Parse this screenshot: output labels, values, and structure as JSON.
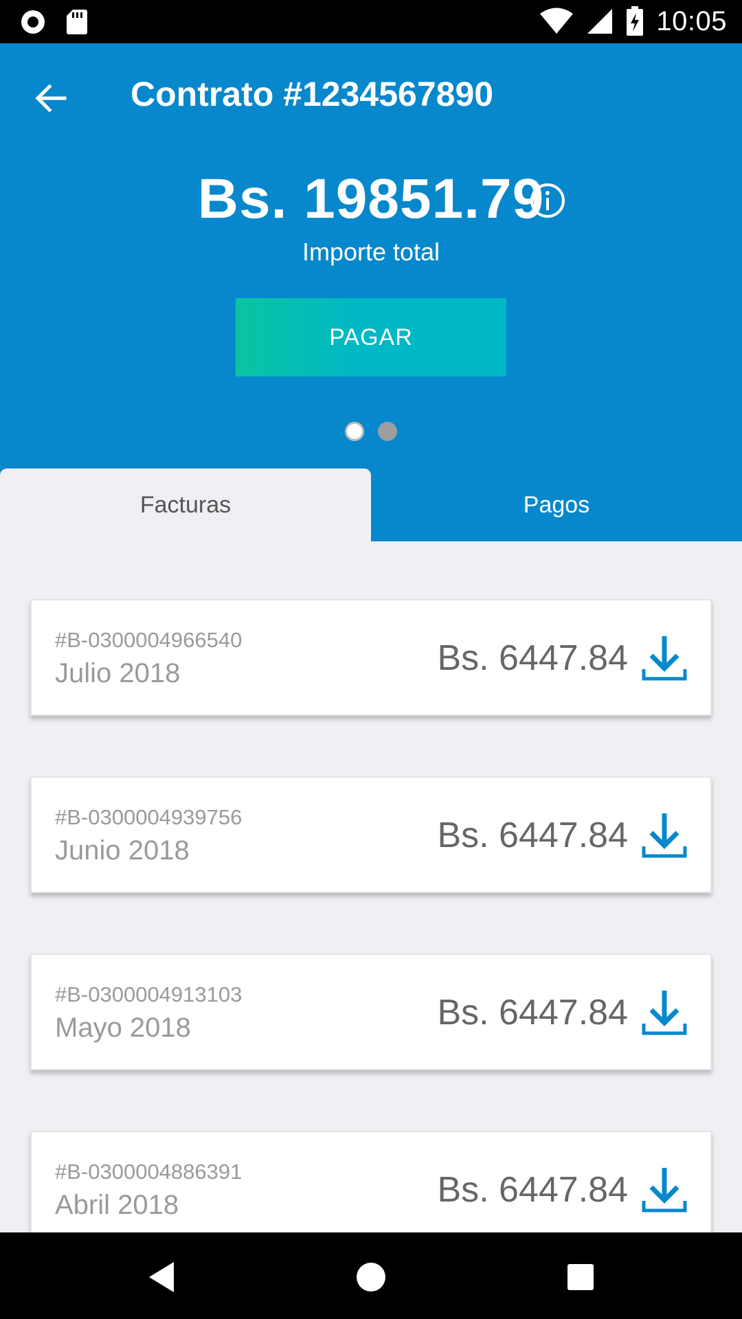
{
  "status_bar": {
    "time": "10:05",
    "icons": [
      "record-icon",
      "sd-card-icon",
      "wifi-icon",
      "signal-icon",
      "battery-charging-icon"
    ]
  },
  "header": {
    "title": "Contrato #1234567890",
    "amount": "Bs. 19851.79",
    "amount_label": "Importe total",
    "pay_label": "PAGAR",
    "background_color": "#0888cc",
    "pager_dots": 2,
    "pager_active_index": 0
  },
  "tabs": [
    {
      "label": "Facturas",
      "selected": true
    },
    {
      "label": "Pagos",
      "selected": false
    }
  ],
  "invoices": [
    {
      "number": "#B-0300004966540",
      "month": "Julio 2018",
      "amount": "Bs. 6447.84"
    },
    {
      "number": "#B-0300004939756",
      "month": "Junio 2018",
      "amount": "Bs. 6447.84"
    },
    {
      "number": "#B-0300004913103",
      "month": "Mayo 2018",
      "amount": "Bs. 6447.84"
    },
    {
      "number": "#B-0300004886391",
      "month": "Abril 2018",
      "amount": "Bs. 6447.84"
    }
  ],
  "colors": {
    "accent": "#0888cc",
    "pay_gradient_start": "#0ac4a2",
    "pay_gradient_end": "#00b8c6",
    "download_icon": "#0888cc"
  },
  "nav": [
    "back-triangle-icon",
    "home-circle-icon",
    "recents-square-icon"
  ]
}
